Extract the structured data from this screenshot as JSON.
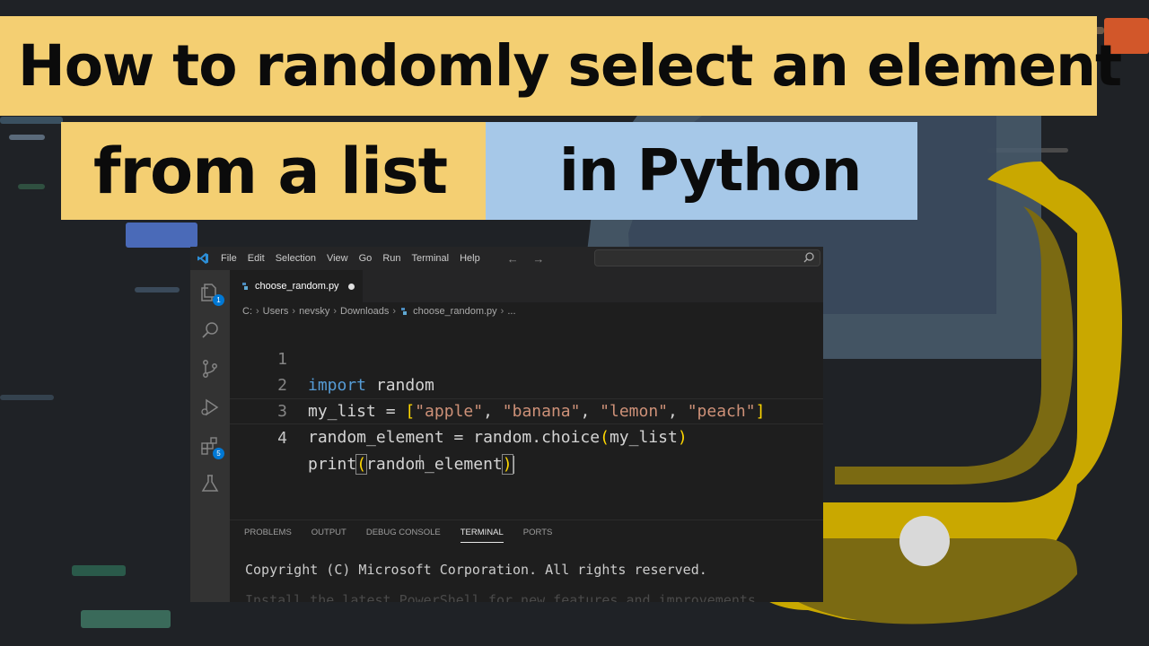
{
  "banner": {
    "line1": "How to randomly select an element",
    "line2_left": "from a list",
    "line2_right": "in Python"
  },
  "window": {
    "menu": [
      "File",
      "Edit",
      "Selection",
      "View",
      "Go",
      "Run",
      "Terminal",
      "Help"
    ],
    "nav_arrows": "← →"
  },
  "activity_bar": {
    "explorer_badge": "1",
    "extensions_badge": "5"
  },
  "tab": {
    "filename": "choose_random.py"
  },
  "breadcrumb": [
    "C:",
    "Users",
    "nevsky",
    "Downloads",
    "choose_random.py",
    "..."
  ],
  "code": {
    "line_numbers": [
      "1",
      "2",
      "3",
      "4"
    ],
    "line1_kw": "import",
    "line1_rest": " random",
    "line2_var": "my_list = ",
    "line2_open": "[",
    "line2_s1": "\"apple\"",
    "line2_s2": "\"banana\"",
    "line2_s3": "\"lemon\"",
    "line2_s4": "\"peach\"",
    "line2_close": "]",
    "comma": ", ",
    "line3_a": "random_element = random.choice",
    "line3_open": "(",
    "line3_arg": "my_list",
    "line3_close": ")",
    "line4_a": "print",
    "line4_open": "(",
    "line4_arg": "random_element",
    "line4_close": ")"
  },
  "panel": {
    "tabs": [
      "PROBLEMS",
      "OUTPUT",
      "DEBUG CONSOLE",
      "TERMINAL",
      "PORTS"
    ],
    "active_tab": "TERMINAL",
    "terminal_line": "Copyright (C) Microsoft Corporation. All rights reserved.",
    "terminal_faded": "Install the latest PowerShell for new features and improvements"
  },
  "colors": {
    "banner_yellow": "#f4cf72",
    "banner_blue": "#a6c8e8",
    "python_yellow": "#c9a800",
    "python_blue": "#4a5d6e",
    "keyword": "#569cd6",
    "string": "#ce9178",
    "badge": "#0078d4"
  }
}
